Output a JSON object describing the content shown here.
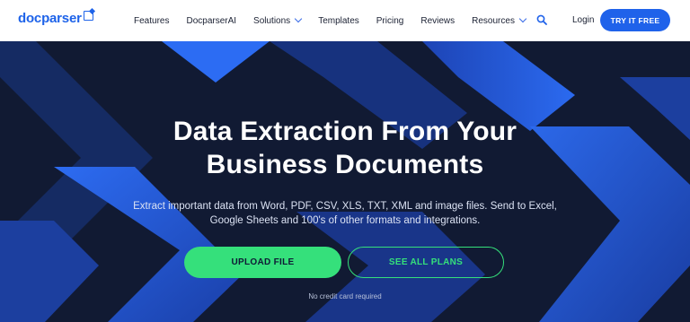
{
  "brand": {
    "name": "docparser",
    "accent": "#1f62ea",
    "green": "#35e07b",
    "hero_bg": "#111a33"
  },
  "nav": {
    "items": [
      {
        "label": "Features"
      },
      {
        "label": "DocparserAI"
      },
      {
        "label": "Solutions",
        "dropdown": true
      },
      {
        "label": "Templates"
      },
      {
        "label": "Pricing"
      },
      {
        "label": "Reviews"
      },
      {
        "label": "Resources",
        "dropdown": true
      }
    ],
    "search_icon": "search-icon",
    "login": "Login",
    "cta": "TRY IT FREE"
  },
  "hero": {
    "headline_line1": "Data Extraction From Your",
    "headline_line2": "Business Documents",
    "sub_line1": "Extract important data from Word, PDF, CSV, XLS, TXT, XML and image files. Send to Excel,",
    "sub_line2": "Google Sheets and 100's of other formats and integrations.",
    "primary_button": "UPLOAD FILE",
    "secondary_button": "SEE ALL PLANS",
    "note": "No credit card required"
  }
}
